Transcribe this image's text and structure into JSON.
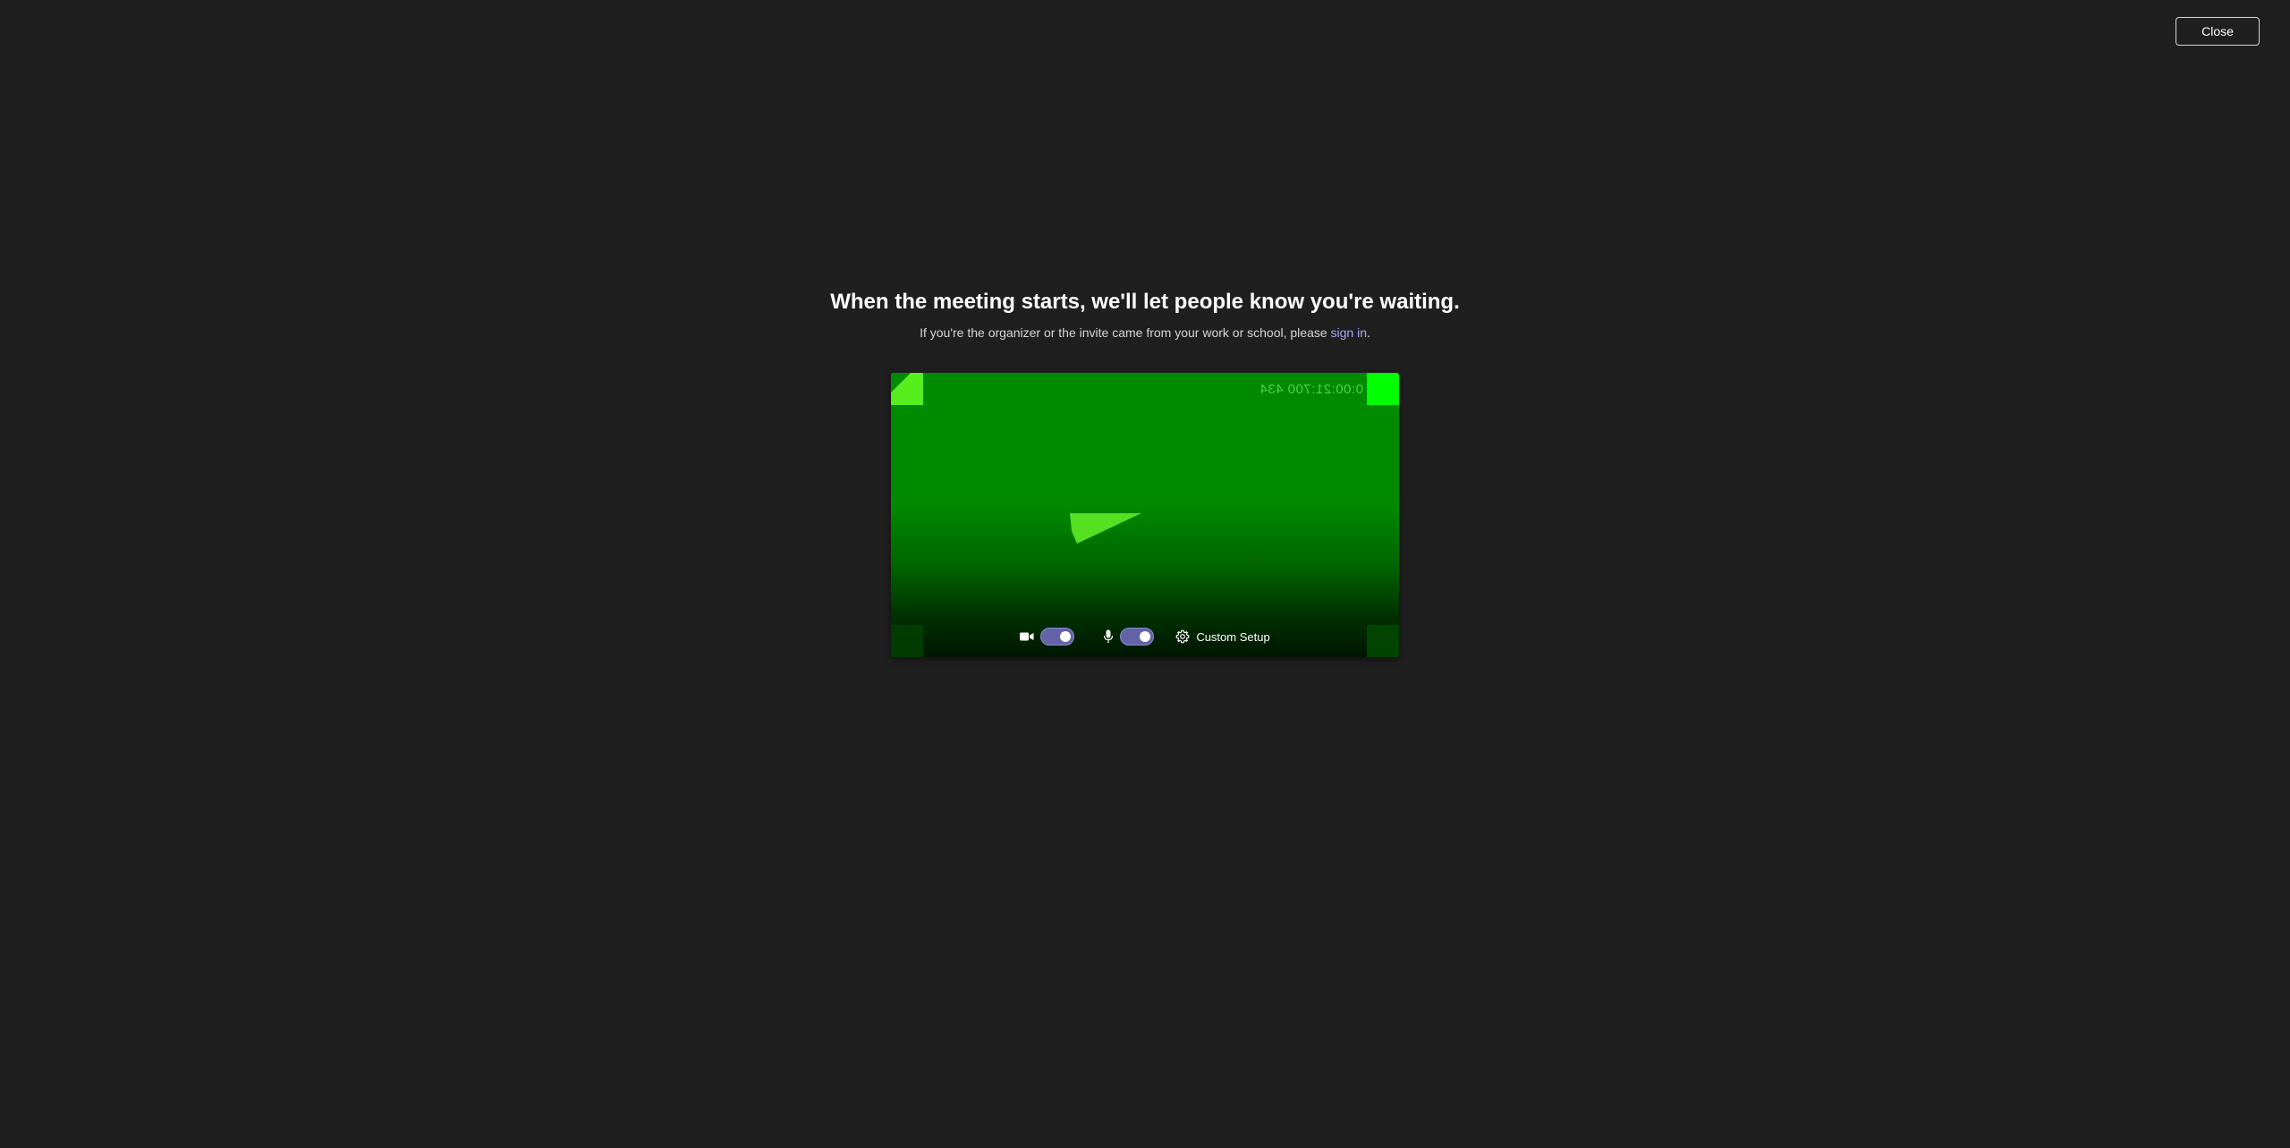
{
  "header": {
    "close_label": "Close"
  },
  "main": {
    "headline": "When the meeting starts, we'll let people know you're waiting.",
    "subtitle_prefix": "If you're the organizer or the invite came from your work or school, please ",
    "sign_in_link": "sign in",
    "subtitle_suffix": "."
  },
  "preview": {
    "timestamp": "0:00:21:700 434",
    "camera": {
      "icon": "video-camera-icon",
      "enabled": true
    },
    "microphone": {
      "icon": "microphone-icon",
      "enabled": true
    },
    "settings": {
      "icon": "gear-icon",
      "label": "Custom Setup"
    }
  },
  "colors": {
    "background": "#1f1f1f",
    "accent": "#6264a7",
    "link": "#a7a8f5",
    "preview_green": "#008a00"
  }
}
